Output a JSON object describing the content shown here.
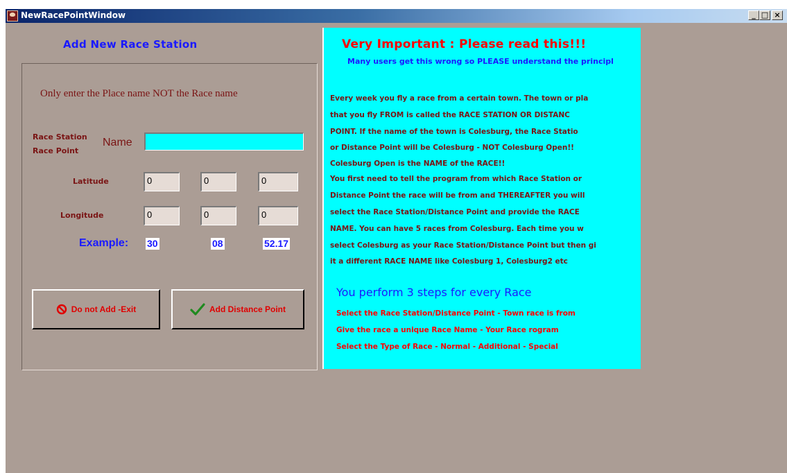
{
  "window": {
    "title": "NewRacePointWindow"
  },
  "title_controls": {
    "minimize": "_",
    "maximize": "□",
    "close": "×"
  },
  "form": {
    "heading": "Add New Race Station",
    "instruction": "Only enter the Place name NOT the Race name",
    "race_station_label": "Race Station",
    "race_point_label": "Race Point",
    "name_label": "Name",
    "name_value": "",
    "latitude_label": "Latitude",
    "latitude_values": [
      "0",
      "0",
      "0"
    ],
    "longitude_label": "Longitude",
    "longitude_values": [
      "0",
      "0",
      "0"
    ],
    "example_label": "Example:",
    "example_values": [
      "30",
      "08",
      "52.17"
    ],
    "cancel_label": "Do not Add -Exit",
    "add_label": "Add Distance Point"
  },
  "info": {
    "title": "Very Important :  Please read this!!!",
    "subtitle": "Many users get this wrong so PLEASE understand the principl",
    "paragraph_lines": [
      "Every week you fly a race from a certain town.  The town or pla",
      "that you fly FROM is called the RACE STATION OR DISTANC",
      "POINT.  If the name of the town is Colesburg, the Race Statio",
      "or Distance Point will be Colesburg - NOT Colesburg Open!!",
      "Colesburg Open is the NAME of the RACE!!",
      "You first need to tell the program from which Race Station or",
      "Distance Point the race will be from and THEREAFTER you will",
      "select the Race Station/Distance Point and provide the RACE",
      "NAME.  You can have 5 races from Colesburg.  Each time you w",
      "select Colesburg as your Race Station/Distance Point but then gi",
      "it a different RACE NAME like Colesburg 1, Colesburg2 etc"
    ],
    "steps_title": "You perform 3 steps for every Race",
    "steps": [
      "Select the Race Station/Distance Point  -  Town race is from",
      "Give the race a unique Race Name  -  Your Race rogram",
      "Select the Type of Race  -  Normal  -   Additional  -  Special"
    ]
  },
  "colors": {
    "window_bg": "#ab9d95",
    "panel_bg": "#00ffff",
    "heading_blue": "#1a1aff",
    "label_maroon": "#7a1414",
    "alert_red": "#ff0000"
  },
  "icons": {
    "app": "race-app-icon",
    "cancel": "prohibited-icon",
    "add": "checkmark-icon"
  }
}
